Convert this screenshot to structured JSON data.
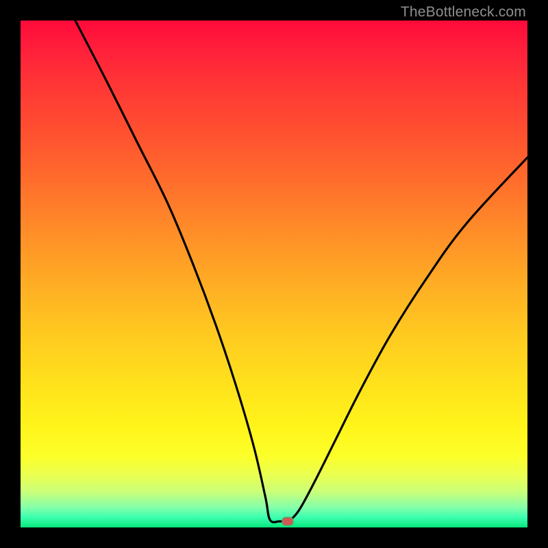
{
  "watermark": "TheBottleneck.com",
  "marker": {
    "color": "#cf5a55",
    "stroke": "#5aa66a"
  },
  "chart_data": {
    "type": "line",
    "title": "",
    "xlabel": "",
    "ylabel": "",
    "xlim": [
      0,
      100
    ],
    "ylim": [
      0,
      100
    ],
    "grid": false,
    "curve": {
      "description": "V-shaped curve with minimum near x≈51. Left branch descends from top-left (y=100) with slight curvature. Right branch rises toward upper-right, concave.",
      "min_x": 51,
      "min_y": 0,
      "left_branch": [
        {
          "x": 10.8,
          "y": 100
        },
        {
          "x": 17,
          "y": 88
        },
        {
          "x": 23,
          "y": 76
        },
        {
          "x": 29,
          "y": 64
        },
        {
          "x": 34,
          "y": 52
        },
        {
          "x": 38.5,
          "y": 40
        },
        {
          "x": 42.5,
          "y": 28
        },
        {
          "x": 46,
          "y": 16
        },
        {
          "x": 48.3,
          "y": 6
        },
        {
          "x": 49.2,
          "y": 1.5
        },
        {
          "x": 51,
          "y": 1.2
        }
      ],
      "right_branch": [
        {
          "x": 53,
          "y": 1.2
        },
        {
          "x": 55,
          "y": 3.5
        },
        {
          "x": 58,
          "y": 9
        },
        {
          "x": 62,
          "y": 17
        },
        {
          "x": 67,
          "y": 27
        },
        {
          "x": 73,
          "y": 38
        },
        {
          "x": 80,
          "y": 49
        },
        {
          "x": 88,
          "y": 60
        },
        {
          "x": 100,
          "y": 73
        }
      ]
    },
    "marker_point": {
      "x": 52.7,
      "y": 1.2
    }
  }
}
